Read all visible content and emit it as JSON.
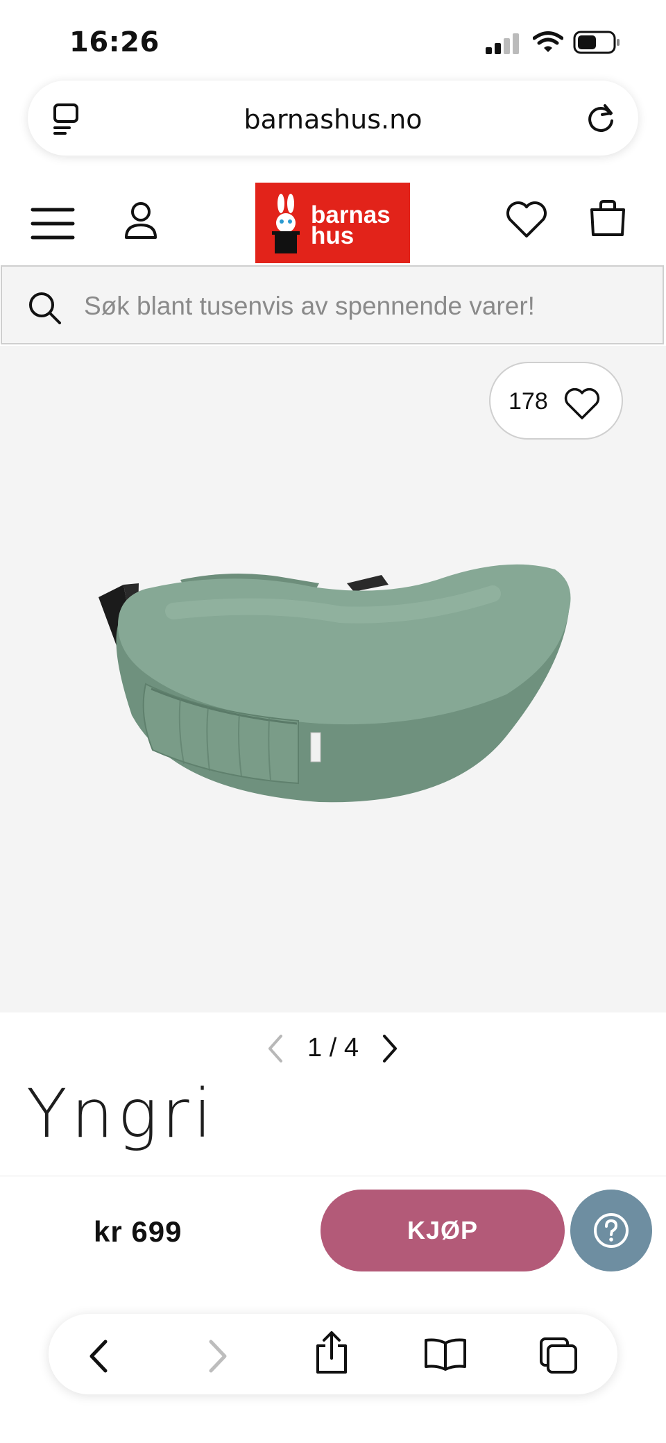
{
  "status_bar": {
    "time": "16:26",
    "icons": [
      "cellular-signal-icon",
      "wifi-icon",
      "battery-icon"
    ]
  },
  "browser": {
    "url": "barnashus.no",
    "icons": [
      "tabs-overview-icon",
      "reload-icon"
    ]
  },
  "header": {
    "logo_line1": "barnas",
    "logo_line2": "hus",
    "logo_color": "#e2231a",
    "icons": [
      "menu-icon",
      "account-icon",
      "wishlist-icon",
      "cart-icon"
    ]
  },
  "search": {
    "placeholder": "Søk blant tusenvis av spennende varer!"
  },
  "product": {
    "favorites_count": "178",
    "image_pager": "1 / 4",
    "brand": "Yngri",
    "color": "#7a9c88"
  },
  "buy_bar": {
    "price": "kr 699",
    "buy_label": "KJØP",
    "buy_color": "#b35a78",
    "help_color": "#6e8ea1"
  },
  "toolbar": {
    "icons": [
      "back-icon",
      "forward-icon",
      "share-icon",
      "bookmarks-icon",
      "tabs-icon"
    ]
  }
}
